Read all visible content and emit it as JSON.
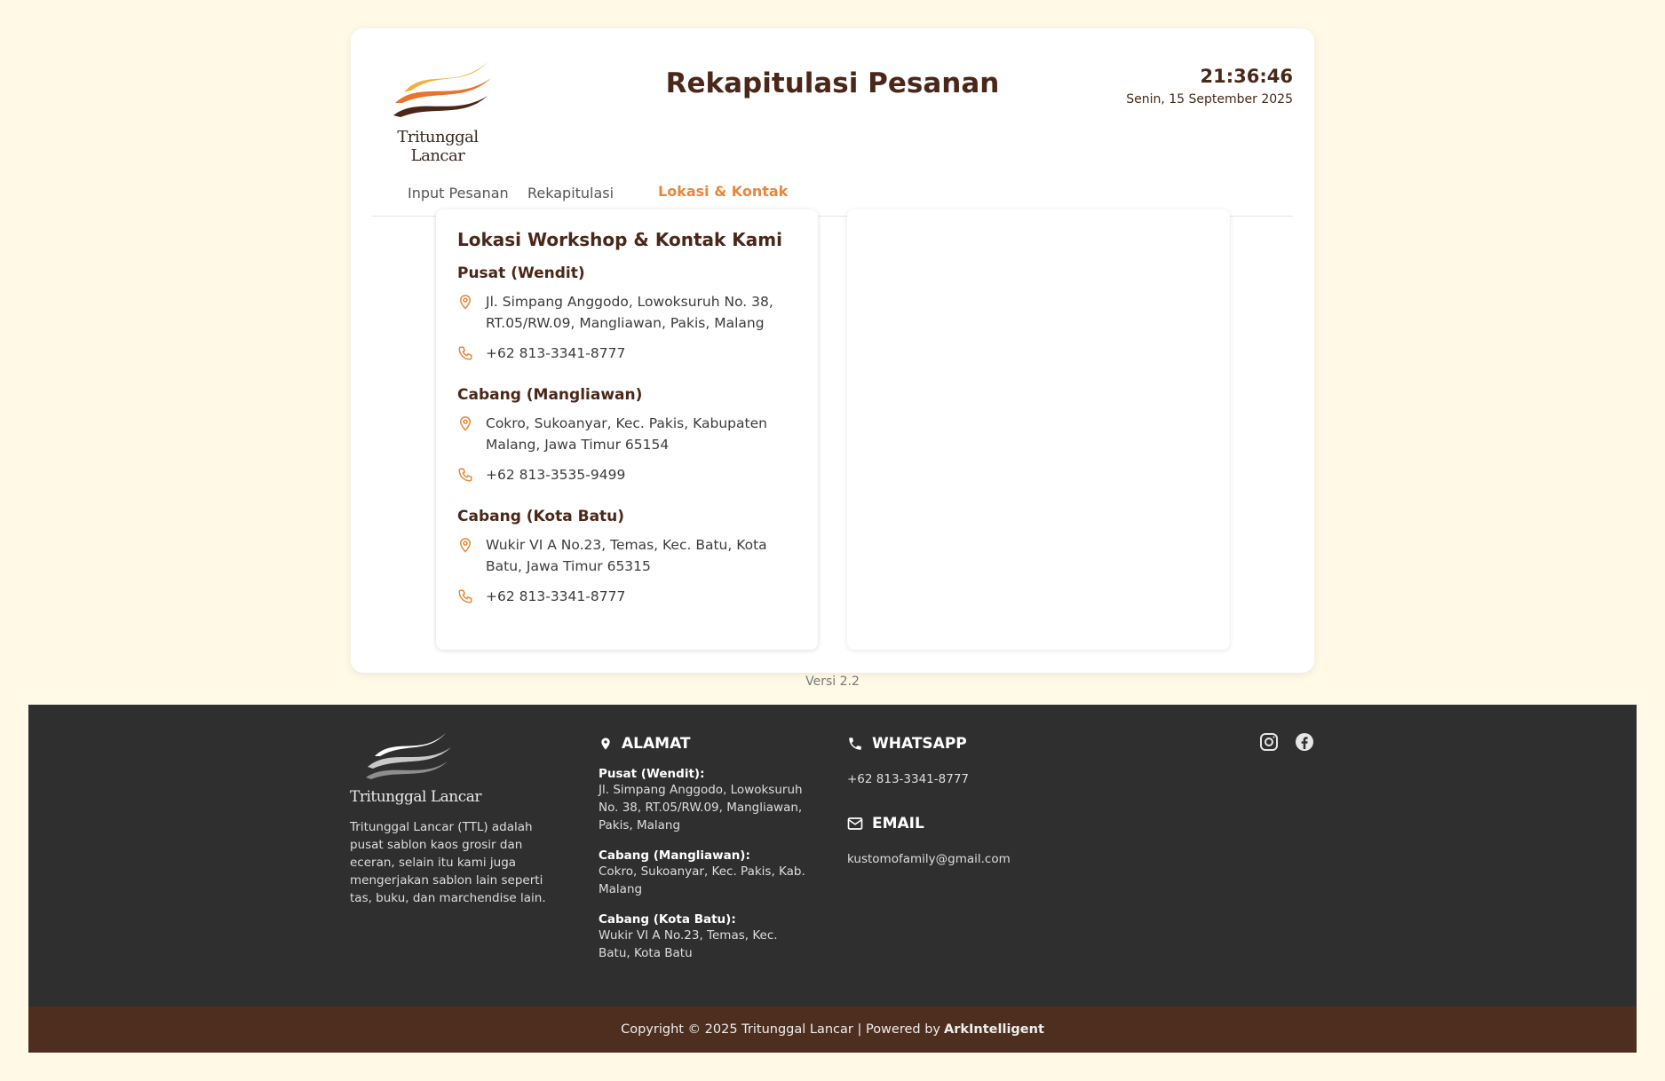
{
  "brand": {
    "name": "Tritunggal Lancar"
  },
  "header": {
    "title": "Rekapitulasi Pesanan",
    "time": "21:36:46",
    "date": "Senin, 15 September 2025"
  },
  "tabs": [
    {
      "label": "Input Pesanan",
      "active": false
    },
    {
      "label": "Rekapitulasi",
      "active": false
    },
    {
      "label": "Lokasi & Kontak",
      "active": true
    }
  ],
  "contact": {
    "title": "Lokasi Workshop & Kontak Kami",
    "branches": [
      {
        "name": "Pusat (Wendit)",
        "address": "Jl. Simpang Anggodo, Lowoksuruh No. 38, RT.05/RW.09, Mangliawan, Pakis, Malang",
        "phone": "+62 813-3341-8777"
      },
      {
        "name": "Cabang (Mangliawan)",
        "address": "Cokro, Sukoanyar, Kec. Pakis, Kabupaten Malang, Jawa Timur 65154",
        "phone": "+62 813-3535-9499"
      },
      {
        "name": "Cabang (Kota Batu)",
        "address": "Wukir VI A No.23, Temas, Kec. Batu, Kota Batu, Jawa Timur 65315",
        "phone": "+62 813-3341-8777"
      }
    ]
  },
  "version": "Versi 2.2",
  "footer": {
    "about": "Tritunggal Lancar (TTL) adalah pusat sablon kaos grosir dan eceran, selain itu kami juga mengerjakan sablon lain seperti tas, buku, dan marchendise lain.",
    "address_heading": "ALAMAT",
    "addresses": [
      {
        "label": "Pusat (Wendit):",
        "text": "Jl. Simpang Anggodo, Lowoksuruh No. 38, RT.05/RW.09, Mangliawan, Pakis, Malang"
      },
      {
        "label": "Cabang (Mangliawan):",
        "text": "Cokro, Sukoanyar, Kec. Pakis, Kab. Malang"
      },
      {
        "label": "Cabang (Kota Batu):",
        "text": "Wukir VI A No.23, Temas, Kec. Batu, Kota Batu"
      }
    ],
    "whatsapp_heading": "WHATSAPP",
    "whatsapp": "+62 813-3341-8777",
    "email_heading": "EMAIL",
    "email": "kustomofamily@gmail.com",
    "socials": [
      "instagram-icon",
      "facebook-icon"
    ]
  },
  "copyright": {
    "text": "Copyright © 2025 Tritunggal Lancar | Powered by",
    "powered_by": "ArkIntelligent"
  },
  "colors": {
    "accent": "#e8873a",
    "brown": "#4a2718",
    "footer_bg": "#2f2f2f",
    "copyright_bg": "#4e2e1f",
    "page_bg": "#fff9e6"
  }
}
